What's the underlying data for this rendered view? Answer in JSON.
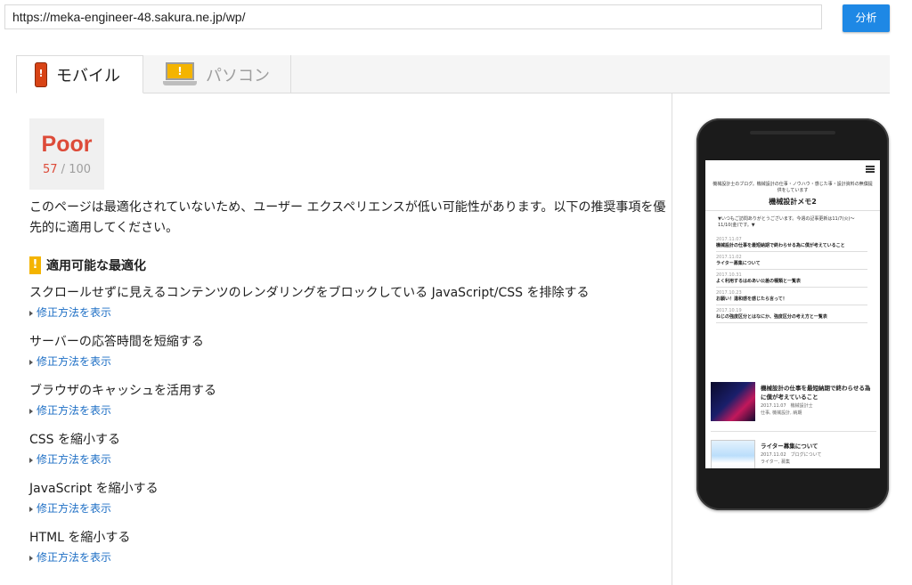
{
  "url_bar": {
    "value": "https://meka-engineer-48.sakura.ne.jp/wp/"
  },
  "analyze_button": {
    "label": "分析"
  },
  "tabs": [
    {
      "label": "モバイル",
      "icon": "mobile-phone-icon",
      "active": true
    },
    {
      "label": "パソコン",
      "icon": "desktop-monitor-icon",
      "active": false
    }
  ],
  "score": {
    "label": "Poor",
    "value": "57",
    "separator": " / ",
    "max": "100"
  },
  "summary": "このページは最適化されていないため、ユーザー エクスペリエンスが低い可能性があります。以下の推奨事項を優先的に適用してください。",
  "section": {
    "title": "適用可能な最適化",
    "icon": "warning-icon"
  },
  "rules": [
    {
      "title": "スクロールせずに見えるコンテンツのレンダリングをブロックしている JavaScript/CSS を排除する",
      "link": "修正方法を表示"
    },
    {
      "title": "サーバーの応答時間を短縮する",
      "link": "修正方法を表示"
    },
    {
      "title": "ブラウザのキャッシュを活用する",
      "link": "修正方法を表示"
    },
    {
      "title": "CSS を縮小する",
      "link": "修正方法を表示"
    },
    {
      "title": "JavaScript を縮小する",
      "link": "修正方法を表示"
    },
    {
      "title": "HTML を縮小する",
      "link": "修正方法を表示"
    }
  ],
  "preview": {
    "tagline": "機械設計士のブログ。機械設計の仕事・ノウハウ・感じた事・設計資料の無償提供をしています",
    "site_title": "機械設計メモ2",
    "notice": "▼いつもご訪問ありがとうございます。今週の記事更新は11/7(火)〜11/10(金)です。▼",
    "news": [
      {
        "date": "2017.11.07",
        "title": "機械設計の仕事を最短納期で終わらせる為に僕が考えていること"
      },
      {
        "date": "2017.11.02",
        "title": "ライター募集について"
      },
      {
        "date": "2017.10.31",
        "title": "よく利用するはめあい公差の種類と一覧表"
      },
      {
        "date": "2017.10.23",
        "title": "お願い！違和感を感じたら言って！"
      },
      {
        "date": "2017.10.19",
        "title": "ねじの強度区分とはなにか、強度区分の考え方と一覧表"
      }
    ],
    "cards": [
      {
        "title": "機械設計の仕事を最短納期で終わらせる為に僕が考えていること",
        "meta1": "2017.11.07　機械設計士",
        "meta2": "仕事, 機械設計, 納期"
      },
      {
        "title": "ライター募集について",
        "meta1": "2017.11.02　ブログについて",
        "meta2": "ライター, 募集"
      }
    ]
  },
  "colors": {
    "poor": "#dd4b39",
    "accent": "#1e88e5",
    "warning": "#f4b400",
    "link": "#1e6fc5"
  }
}
